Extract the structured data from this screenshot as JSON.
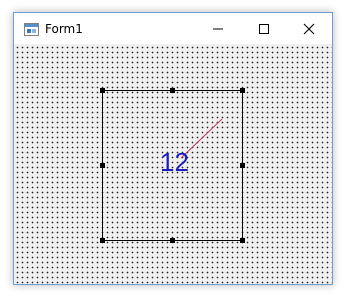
{
  "window": {
    "title": "Form1",
    "controls": {
      "minimize": "minimize",
      "maximize": "maximize",
      "close": "close"
    }
  },
  "form": {
    "background": "#f0f0f0",
    "grid_dots": true
  },
  "selected_control": {
    "display_value": "12",
    "text_color": "#1d1dbd",
    "hand_color": "#c0365b",
    "selection_handles": 8
  },
  "icons": {
    "app": "form-window-icon",
    "minimize": "minimize-icon",
    "maximize": "maximize-icon",
    "close": "close-icon"
  }
}
